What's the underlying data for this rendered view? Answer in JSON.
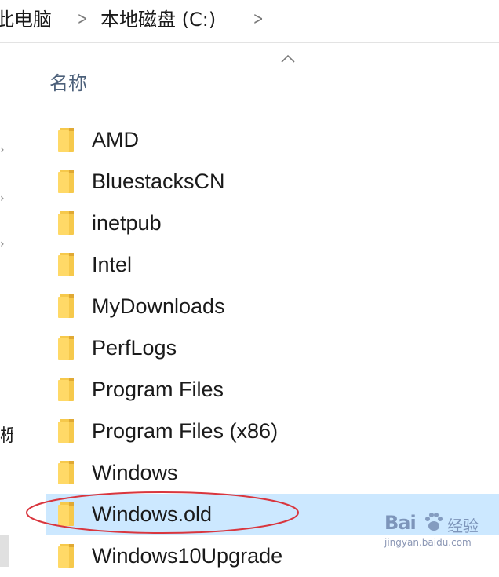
{
  "breadcrumb": {
    "items": [
      "此电脑",
      "本地磁盘 (C:)"
    ],
    "separator": ">"
  },
  "nav_pane": {
    "partial_text": "栎"
  },
  "file_list": {
    "column_header": "名称",
    "sort": "ascending",
    "items": [
      {
        "name": "AMD",
        "icon": "folder-icon",
        "selected": false
      },
      {
        "name": "BluestacksCN",
        "icon": "folder-icon",
        "selected": false
      },
      {
        "name": "inetpub",
        "icon": "folder-icon",
        "selected": false
      },
      {
        "name": "Intel",
        "icon": "folder-icon",
        "selected": false
      },
      {
        "name": "MyDownloads",
        "icon": "folder-icon",
        "selected": false
      },
      {
        "name": "PerfLogs",
        "icon": "folder-icon",
        "selected": false
      },
      {
        "name": "Program Files",
        "icon": "folder-icon",
        "selected": false
      },
      {
        "name": "Program Files (x86)",
        "icon": "folder-icon",
        "selected": false
      },
      {
        "name": "Windows",
        "icon": "folder-icon",
        "selected": false
      },
      {
        "name": "Windows.old",
        "icon": "folder-icon",
        "selected": true
      },
      {
        "name": "Windows10Upgrade",
        "icon": "folder-icon",
        "selected": false
      }
    ]
  },
  "annotation": {
    "type": "red-ellipse",
    "target": "Windows.old",
    "color": "#d9363e"
  },
  "watermark": {
    "brand": "Bai",
    "brand_suffix": "经验",
    "url": "jingyan.baidu.com"
  },
  "colors": {
    "selection": "#cce8ff",
    "header_text": "#4c607a",
    "folder": "#ffd967"
  }
}
